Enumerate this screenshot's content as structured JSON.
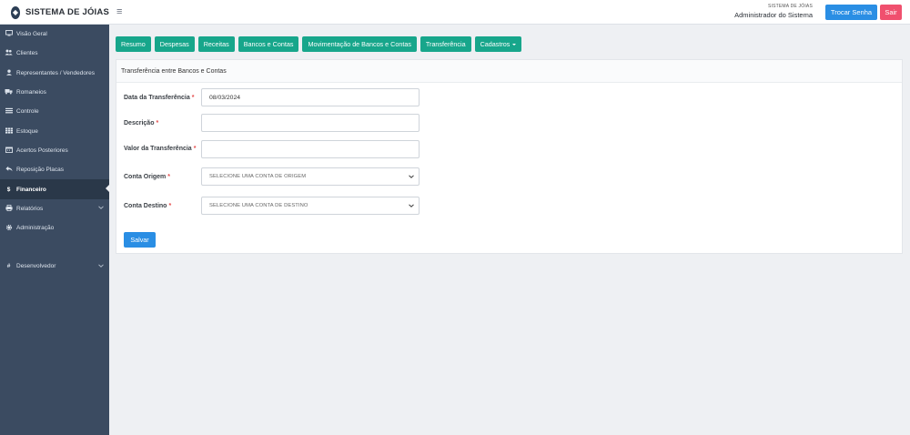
{
  "header": {
    "app_name": "SISTEMA DE JÓIAS",
    "menu_toggle_icon": "≡",
    "user_system_label": "SISTEMA DE JÓIAS",
    "user_name": "Administrador do Sistema",
    "change_password_label": "Trocar Senha",
    "logout_label": "Sair"
  },
  "sidebar": {
    "items": [
      {
        "label": "Visão Geral",
        "icon": "monitor-icon"
      },
      {
        "label": "Clientes",
        "icon": "users-icon"
      },
      {
        "label": "Representantes / Vendedores",
        "icon": "user-secret-icon"
      },
      {
        "label": "Romaneios",
        "icon": "truck-icon"
      },
      {
        "label": "Controle",
        "icon": "list-icon"
      },
      {
        "label": "Estoque",
        "icon": "grid-icon"
      },
      {
        "label": "Acertos Posteriores",
        "icon": "calendar-icon"
      },
      {
        "label": "Reposição Placas",
        "icon": "reply-icon"
      },
      {
        "label": "Financeiro",
        "icon": "dollar-icon",
        "active": true
      },
      {
        "label": "Relatórios",
        "icon": "print-icon"
      },
      {
        "label": "Administração",
        "icon": "gear-icon"
      },
      {
        "label": "Desenvolvedor",
        "icon": "hash-icon"
      }
    ]
  },
  "tabs": [
    {
      "label": "Resumo"
    },
    {
      "label": "Despesas"
    },
    {
      "label": "Receitas"
    },
    {
      "label": "Bancos e Contas"
    },
    {
      "label": "Movimentação de Bancos e Contas"
    },
    {
      "label": "Transferência"
    },
    {
      "label": "Cadastros"
    }
  ],
  "panel": {
    "title": "Transferência entre Bancos e Contas"
  },
  "form": {
    "date_label": "Data da Transferência",
    "date_value": "08/03/2024",
    "description_label": "Descrição",
    "description_value": "",
    "amount_label": "Valor da Transferência",
    "amount_value": "",
    "source_label": "Conta Origem",
    "source_selected": "SELECIONE UMA CONTA DE ORIGEM",
    "destination_label": "Conta Destino",
    "destination_selected": "SELECIONE UMA CONTA DE DESTINO",
    "required_mark": "*",
    "save_label": "Salvar"
  },
  "colors": {
    "sidebar_bg": "#3b4b61",
    "sidebar_active_bg": "#2a3849",
    "tab_green": "#17a68b",
    "primary_blue": "#2a8ee4",
    "logout_pink": "#f0506e",
    "required_red": "#e54b4b"
  }
}
